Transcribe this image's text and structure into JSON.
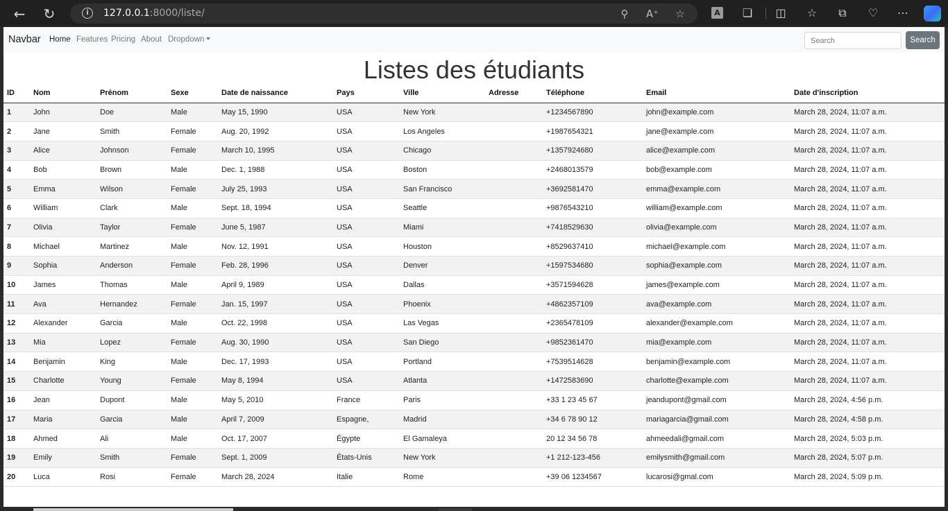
{
  "browser": {
    "url_host": "127.0.0.1",
    "url_rest": ":8000/liste/",
    "account_initial": "A"
  },
  "navbar": {
    "brand": "Navbar",
    "links": [
      "Home",
      "Features",
      "Pricing",
      "About",
      "Dropdown"
    ],
    "search_placeholder": "Search",
    "search_button": "Search"
  },
  "page": {
    "title": "Listes des étudiants"
  },
  "table": {
    "headers": [
      "ID",
      "Nom",
      "Prénom",
      "Sexe",
      "Date de naissance",
      "Pays",
      "Ville",
      "Adresse",
      "Téléphone",
      "Email",
      "Date d'inscription"
    ],
    "rows": [
      [
        "1",
        "John",
        "Doe",
        "Male",
        "May 15, 1990",
        "USA",
        "New York",
        "",
        "+1234567890",
        "john@example.com",
        "March 28, 2024, 11:07 a.m."
      ],
      [
        "2",
        "Jane",
        "Smith",
        "Female",
        "Aug. 20, 1992",
        "USA",
        "Los Angeles",
        "",
        "+1987654321",
        "jane@example.com",
        "March 28, 2024, 11:07 a.m."
      ],
      [
        "3",
        "Alice",
        "Johnson",
        "Female",
        "March 10, 1995",
        "USA",
        "Chicago",
        "",
        "+1357924680",
        "alice@example.com",
        "March 28, 2024, 11:07 a.m."
      ],
      [
        "4",
        "Bob",
        "Brown",
        "Male",
        "Dec. 1, 1988",
        "USA",
        "Boston",
        "",
        "+2468013579",
        "bob@example.com",
        "March 28, 2024, 11:07 a.m."
      ],
      [
        "5",
        "Emma",
        "Wilson",
        "Female",
        "July 25, 1993",
        "USA",
        "San Francisco",
        "",
        "+3692581470",
        "emma@example.com",
        "March 28, 2024, 11:07 a.m."
      ],
      [
        "6",
        "William",
        "Clark",
        "Male",
        "Sept. 18, 1994",
        "USA",
        "Seattle",
        "",
        "+9876543210",
        "william@example.com",
        "March 28, 2024, 11:07 a.m."
      ],
      [
        "7",
        "Olivia",
        "Taylor",
        "Female",
        "June 5, 1987",
        "USA",
        "Miami",
        "",
        "+7418529630",
        "olivia@example.com",
        "March 28, 2024, 11:07 a.m."
      ],
      [
        "8",
        "Michael",
        "Martinez",
        "Male",
        "Nov. 12, 1991",
        "USA",
        "Houston",
        "",
        "+8529637410",
        "michael@example.com",
        "March 28, 2024, 11:07 a.m."
      ],
      [
        "9",
        "Sophia",
        "Anderson",
        "Female",
        "Feb. 28, 1996",
        "USA",
        "Denver",
        "",
        "+1597534680",
        "sophia@example.com",
        "March 28, 2024, 11:07 a.m."
      ],
      [
        "10",
        "James",
        "Thomas",
        "Male",
        "April 9, 1989",
        "USA",
        "Dallas",
        "",
        "+3571594628",
        "james@example.com",
        "March 28, 2024, 11:07 a.m."
      ],
      [
        "11",
        "Ava",
        "Hernandez",
        "Female",
        "Jan. 15, 1997",
        "USA",
        "Phoenix",
        "",
        "+4862357109",
        "ava@example.com",
        "March 28, 2024, 11:07 a.m."
      ],
      [
        "12",
        "Alexander",
        "Garcia",
        "Male",
        "Oct. 22, 1998",
        "USA",
        "Las Vegas",
        "",
        "+2365478109",
        "alexander@example.com",
        "March 28, 2024, 11:07 a.m."
      ],
      [
        "13",
        "Mia",
        "Lopez",
        "Female",
        "Aug. 30, 1990",
        "USA",
        "San Diego",
        "",
        "+9852361470",
        "mia@example.com",
        "March 28, 2024, 11:07 a.m."
      ],
      [
        "14",
        "Benjamin",
        "King",
        "Male",
        "Dec. 17, 1993",
        "USA",
        "Portland",
        "",
        "+7539514628",
        "benjamin@example.com",
        "March 28, 2024, 11:07 a.m."
      ],
      [
        "15",
        "Charlotte",
        "Young",
        "Female",
        "May 8, 1994",
        "USA",
        "Atlanta",
        "",
        "+1472583690",
        "charlotte@example.com",
        "March 28, 2024, 11:07 a.m."
      ],
      [
        "16",
        "Jean",
        "Dupont",
        "Male",
        "May 5, 2010",
        "France",
        "Paris",
        "",
        "+33 1 23 45 67",
        "jeandupont@gmail.com",
        "March 28, 2024, 4:56 p.m."
      ],
      [
        "17",
        "Maria",
        "Garcia",
        "Male",
        "April 7, 2009",
        "Espagne,",
        "Madrid",
        "",
        "+34 6 78 90 12",
        "mariagarcia@gmail.com",
        "March 28, 2024, 4:58 p.m."
      ],
      [
        "18",
        "Ahmed",
        "Ali",
        "Male",
        "Oct. 17, 2007",
        "Égypte",
        "El Gamaleya",
        "",
        "20 12 34 56 78",
        "ahmeedali@gmail.com",
        "March 28, 2024, 5:03 p.m."
      ],
      [
        "19",
        "Emily",
        "Smith",
        "Female",
        "Sept. 1, 2009",
        "États-Unis",
        "New York",
        "",
        "+1 212-123-456",
        "emilysmith@gmail.com",
        "March 28, 2024, 5:07 p.m."
      ],
      [
        "20",
        "Luca",
        "Rosi",
        "Female",
        "March 28, 2024",
        "Italie",
        "Rome",
        "",
        "+39 06 1234567",
        "lucarosi@gmal.com",
        "March 28, 2024, 5:09 p.m."
      ]
    ]
  }
}
